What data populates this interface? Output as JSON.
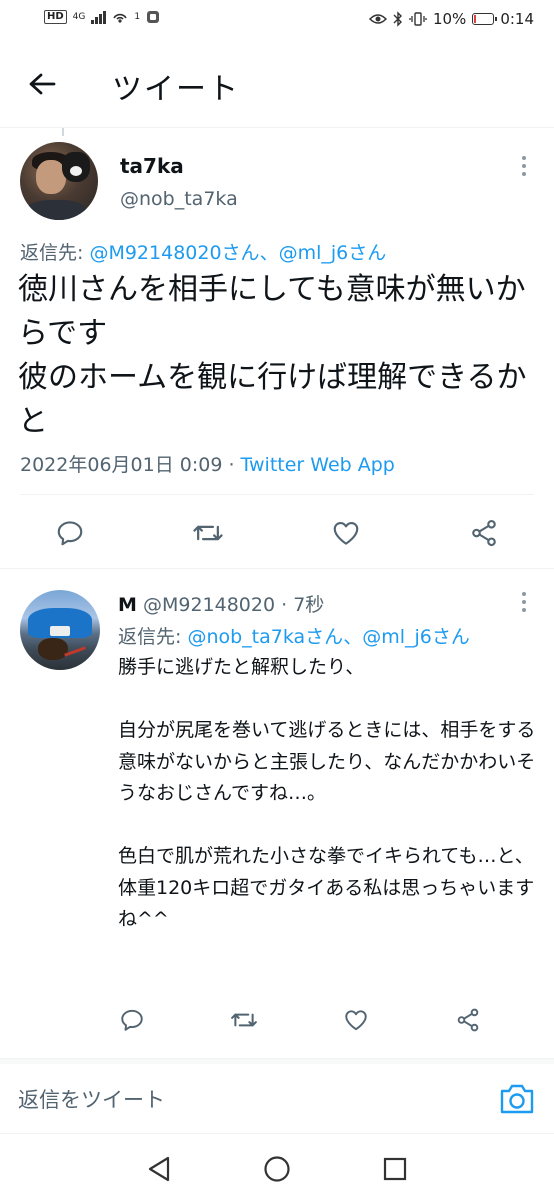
{
  "status_bar": {
    "network": "HD",
    "network_type": "4G",
    "notification_count": "1",
    "battery_percent": "10%",
    "battery_level": 0.1,
    "time": "0:14"
  },
  "header": {
    "title": "ツイート",
    "back_icon": "arrow-left-icon"
  },
  "main_tweet": {
    "display_name": "ta7ka",
    "handle": "@nob_ta7ka",
    "reply_prefix": "返信先: ",
    "reply_mention_1": "@M92148020さん",
    "reply_separator": "、",
    "reply_mention_2": "@ml_j6さん",
    "text": "徳川さんを相手にしても意味が無いからです\n彼のホームを観に行けば理解できるかと",
    "timestamp": "2022年06月01日 0:09",
    "meta_separator": " · ",
    "source_app": "Twitter Web App"
  },
  "reply_tweet": {
    "display_name": "M",
    "handle": "@M92148020",
    "time_separator": " · ",
    "time_ago": "7秒",
    "reply_prefix": "返信先: ",
    "reply_mention_1": "@nob_ta7kaさん",
    "reply_separator": "、",
    "reply_mention_2": "@ml_j6さん",
    "text": "勝手に逃げたと解釈したり、\n\n自分が尻尾を巻いて逃げるときには、相手をする意味がないからと主張したり、なんだかかわいそうなおじさんですね…。\n\n色白で肌が荒れた小さな拳でイキられても…と、\n体重120キロ超でガタイある私は思っちゃいますね^^"
  },
  "compose": {
    "placeholder": "返信をツイート"
  },
  "colors": {
    "accent": "#1d9bf0",
    "secondary_text": "#536471",
    "primary_text": "#0f1419",
    "battery_low": "#e0403a"
  },
  "icons": {
    "actions": [
      "reply-icon",
      "retweet-icon",
      "like-icon",
      "share-icon"
    ],
    "compose": "camera-icon",
    "nav": [
      "back-triangle-icon",
      "home-circle-icon",
      "recents-square-icon"
    ]
  }
}
